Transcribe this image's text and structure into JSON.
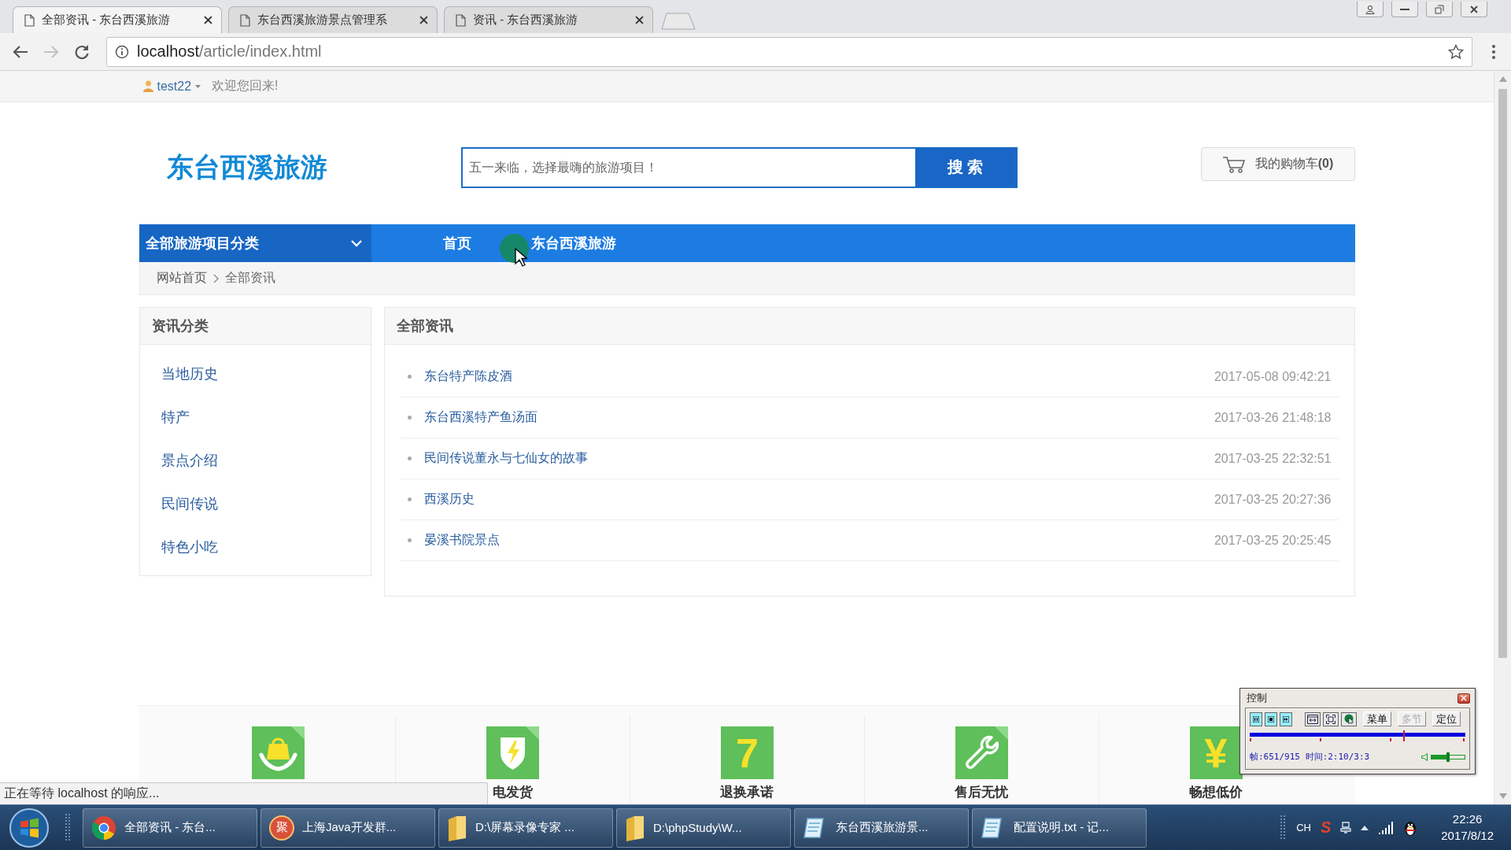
{
  "browser": {
    "tabs": [
      {
        "title": "全部资讯 - 东台西溪旅游",
        "selected": true
      },
      {
        "title": "东台西溪旅游景点管理系",
        "selected": false
      },
      {
        "title": "资讯 - 东台西溪旅游",
        "selected": false
      }
    ],
    "url": {
      "host": "localhost",
      "path": "/article/index.html"
    }
  },
  "topbar": {
    "username": "test22",
    "welcome": "欢迎您回来!"
  },
  "header": {
    "logo": "东台西溪旅游",
    "search": {
      "placeholder": "五一来临，选择最嗨的旅游项目！",
      "button": "搜 索"
    },
    "cart": "我的购物车**(0)**"
  },
  "nav": {
    "category": "全部旅游项目分类",
    "links": [
      "首页",
      "东台西溪旅游"
    ]
  },
  "breadcrumb": [
    "网站首页",
    "全部资讯"
  ],
  "sidebar": {
    "title": "资讯分类",
    "items": [
      "当地历史",
      "特产",
      "景点介绍",
      "民间传说",
      "特色小吃"
    ]
  },
  "news": {
    "title": "全部资讯",
    "rows": [
      {
        "title": "东台特产陈皮酒",
        "date": "2017-05-08 09:42:21"
      },
      {
        "title": "东台西溪特产鱼汤面",
        "date": "2017-03-26 21:48:18"
      },
      {
        "title": "民间传说董永与七仙女的故事",
        "date": "2017-03-25 22:32:51"
      },
      {
        "title": "西溪历史",
        "date": "2017-03-25 20:27:36"
      },
      {
        "title": "晏溪书院景点",
        "date": "2017-03-25 20:25:45"
      }
    ]
  },
  "features": [
    {
      "kind": "bag"
    },
    {
      "kind": "shield",
      "label": "电发货"
    },
    {
      "kind": "glyph",
      "glyph": "7",
      "label": "退换承诺"
    },
    {
      "kind": "wrench",
      "label": "售后无忧"
    },
    {
      "kind": "glyph",
      "glyph": "¥",
      "label": "畅想低价"
    }
  ],
  "status_bubble": "正在等待 localhost 的响应...",
  "recorder": {
    "title": "控制",
    "buttons": [
      {
        "label": "菜单",
        "disabled": false
      },
      {
        "label": "多节",
        "disabled": true
      },
      {
        "label": "定位",
        "disabled": false
      }
    ],
    "progress": {
      "level": 0.71
    },
    "info": "帧:651/915 时间:2:10/3:3",
    "volume": {
      "level": 0.49
    }
  },
  "taskbar": {
    "items": [
      {
        "kind": "chrome",
        "label": "全部资讯 - 东台..."
      },
      {
        "kind": "badge",
        "glyph": "聚",
        "label": "上海Java开发群..."
      },
      {
        "kind": "folder",
        "label": "D:\\屏幕录像专家 ..."
      },
      {
        "kind": "folder",
        "label": "D:\\phpStudy\\W..."
      },
      {
        "kind": "document",
        "label": "东台西溪旅游景..."
      },
      {
        "kind": "document",
        "label": "配置说明.txt - 记..."
      }
    ],
    "tray": {
      "input": "CH",
      "ime": "S"
    },
    "clock": {
      "time": "22:26",
      "date": "2017/8/12"
    }
  }
}
